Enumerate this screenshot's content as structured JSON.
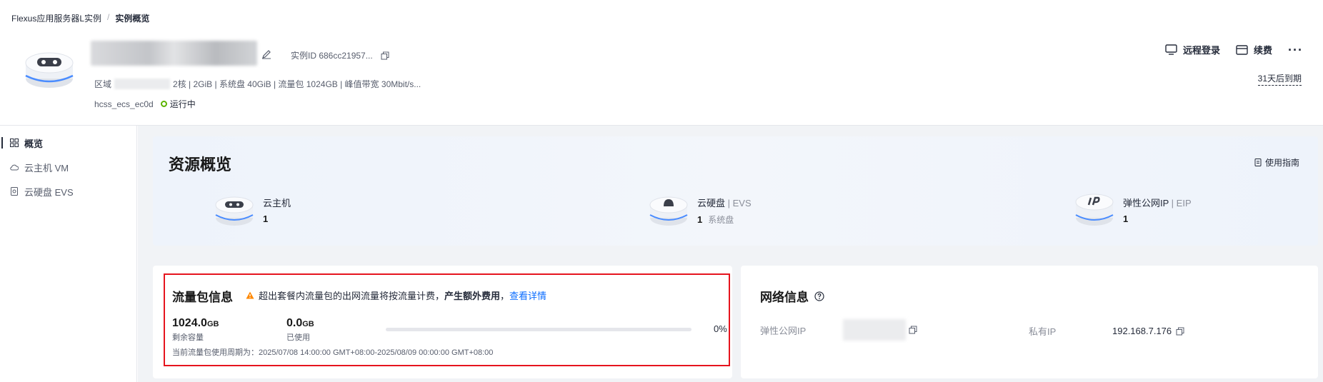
{
  "breadcrumb": {
    "parent": "Flexus应用服务器L实例",
    "separator": "/",
    "current": "实例概览"
  },
  "instance": {
    "id_text": "实例ID 686cc21957...",
    "region_label": "区域",
    "specs": "2核 | 2GiB | 系统盘 40GiB | 流量包 1024GB | 峰值带宽 30Mbit/s...",
    "hostname": "hcss_ecs_ec0d",
    "status": "运行中",
    "status_color": "#5cb300"
  },
  "actions": {
    "remote_login": "远程登录",
    "renew": "续费",
    "more": "···",
    "expire": "31天后到期"
  },
  "sidebar": {
    "items": [
      {
        "label": "概览",
        "icon": "grid-icon"
      },
      {
        "label": "云主机 VM",
        "icon": "cloud-icon"
      },
      {
        "label": "云硬盘 EVS",
        "icon": "disk-icon"
      }
    ]
  },
  "overview": {
    "title": "资源概览",
    "guide": "使用指南",
    "resources": [
      {
        "name": "云主机",
        "sub": "",
        "count": "1",
        "note": ""
      },
      {
        "name": "云硬盘",
        "sub": " | EVS",
        "count": "1",
        "note": "系统盘"
      },
      {
        "name": "弹性公网IP",
        "sub": " | EIP",
        "count": "1",
        "note": ""
      }
    ]
  },
  "traffic": {
    "title": "流量包信息",
    "warning_prefix": "超出套餐内流量包的出网流量将按流量计费，",
    "warning_bold": "产生额外费用",
    "warning_sep": "，",
    "warning_link": "查看详情",
    "remaining_value": "1024.0",
    "remaining_unit": "GB",
    "remaining_label": "剩余容量",
    "used_value": "0.0",
    "used_unit": "GB",
    "used_label": "已使用",
    "usage_fraction": 0,
    "percent": "0%",
    "period": "当前流量包使用周期为：2025/07/08 14:00:00 GMT+08:00-2025/08/09 00:00:00 GMT+08:00",
    "highlight_color": "#e6141e"
  },
  "network": {
    "title": "网络信息",
    "eip_label": "弹性公网IP",
    "private_label": "私有IP",
    "private_ip": "192.168.7.176"
  },
  "colors": {
    "accent": "#0a6cff",
    "warning": "#ff8800"
  }
}
